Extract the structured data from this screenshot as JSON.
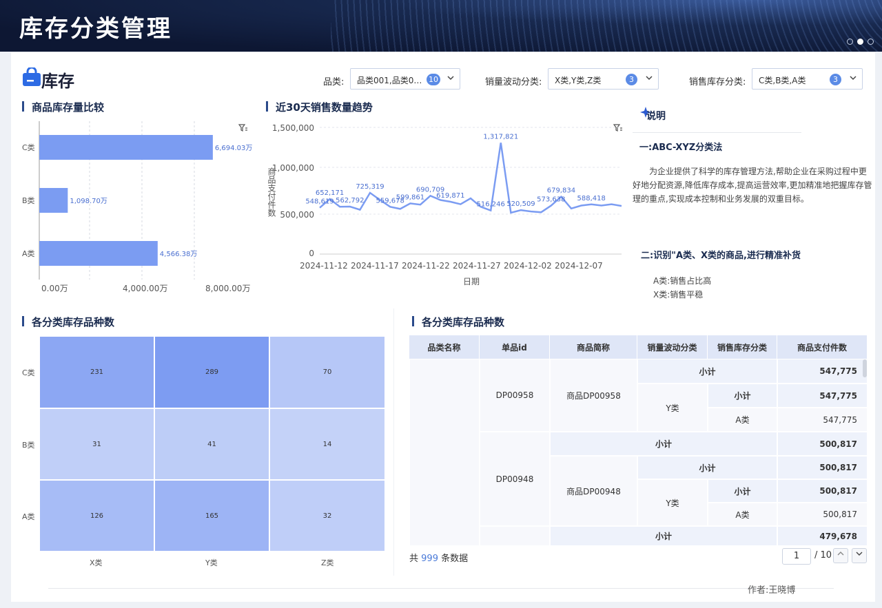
{
  "header": {
    "title": "库存分类管理"
  },
  "logo": {
    "text": "库存"
  },
  "filters": [
    {
      "label": "品类:",
      "value": "品类001,品类0…",
      "count": "10"
    },
    {
      "label": "销量波动分类:",
      "value": "X类,Y类,Z类",
      "count": "3"
    },
    {
      "label": "销售库存分类:",
      "value": "C类,B类,A类",
      "count": "3"
    }
  ],
  "inventory_chart": {
    "title": "商品库存量比较",
    "categories": [
      "C类",
      "B类",
      "A类"
    ],
    "labels": [
      "6,694.03万",
      "1,098.70万",
      "4,566.38万"
    ],
    "ticks": [
      "0.00万",
      "4,000.00万",
      "8,000.00万"
    ]
  },
  "trend_chart": {
    "title": "近30天销售数量趋势",
    "ylabel": "商品支付件数",
    "xlabel": "日期",
    "yticks": [
      "1,500,000",
      "1,000,000",
      "500,000",
      "0"
    ],
    "xticks": [
      "2024-11-12",
      "2024-11-17",
      "2024-11-22",
      "2024-11-27",
      "2024-12-02",
      "2024-12-07"
    ],
    "labels": [
      "548,619",
      "652,171",
      "562,792",
      "725,319",
      "559,678",
      "599,861",
      "690,709",
      "619,871",
      "516,246",
      "1,317,821",
      "520,509",
      "573,638",
      "679,834",
      "588,418"
    ]
  },
  "notes": {
    "title": "说明",
    "h1": "一:ABC-XYZ分类法",
    "p1": "为企业提供了科学的库存管理方法,帮助企业在采购过程中更好地分配资源,降低库存成本,提高运营效率,更加精准地把握库存管理的重点,实现成本控制和业务发展的双重目标。",
    "h2": "二:识别\"A类、X类的商品,进行精准补货",
    "items": [
      "A类:销售占比高",
      "X类:销售平稳"
    ]
  },
  "heatmap": {
    "title": "各分类库存品种数",
    "rows": [
      "C类",
      "B类",
      "A类"
    ],
    "cols": [
      "X类",
      "Y类",
      "Z类"
    ],
    "values": [
      [
        "231",
        "289",
        "70"
      ],
      [
        "31",
        "41",
        "14"
      ],
      [
        "126",
        "165",
        "32"
      ]
    ]
  },
  "table": {
    "title": "各分类库存品种数",
    "columns": [
      "品类名称",
      "单品id",
      "商品简称",
      "销量波动分类",
      "销售库存分类",
      "商品支付件数"
    ],
    "subtotal": "小计",
    "group1": {
      "id": "DP00958",
      "name": "商品DP00958",
      "wave": "Y类",
      "stock": "A类",
      "v1": "547,775",
      "v2": "547,775",
      "v3": "547,775"
    },
    "group2": {
      "id": "DP00948",
      "name": "商品DP00948",
      "wave": "Y类",
      "stock": "A类",
      "v0": "500,817",
      "v1": "500,817",
      "v2": "500,817",
      "v3": "500,817"
    },
    "last_sub": "479,678"
  },
  "pager": {
    "prefix": "共",
    "count": "999",
    "suffix": "条数据",
    "page": "1",
    "total": "/ 10"
  },
  "footer": {
    "author": "作者:王晓博"
  },
  "chart_data": [
    {
      "type": "bar",
      "title": "商品库存量比较",
      "categories": [
        "C类",
        "B类",
        "A类"
      ],
      "values": [
        6694.03,
        1098.7,
        4566.38
      ],
      "unit": "万",
      "xlim": [
        0,
        8000
      ],
      "orientation": "horizontal",
      "color": "#7b9cf2"
    },
    {
      "type": "line",
      "title": "近30天销售数量趋势",
      "xlabel": "日期",
      "ylabel": "商品支付件数",
      "ylim": [
        0,
        1500000
      ],
      "x": [
        "2024-11-10",
        "2024-11-11",
        "2024-11-12",
        "2024-11-13",
        "2024-11-14",
        "2024-11-15",
        "2024-11-16",
        "2024-11-17",
        "2024-11-18",
        "2024-11-19",
        "2024-11-20",
        "2024-11-21",
        "2024-11-22",
        "2024-11-23",
        "2024-11-24",
        "2024-11-25",
        "2024-11-26",
        "2024-11-27",
        "2024-11-28",
        "2024-11-29",
        "2024-11-30",
        "2024-12-01",
        "2024-12-02",
        "2024-12-03",
        "2024-12-04",
        "2024-12-05",
        "2024-12-06",
        "2024-12-07",
        "2024-12-08",
        "2024-12-09",
        "2024-12-10"
      ],
      "values": [
        548619,
        652171,
        560000,
        562792,
        525000,
        725319,
        640000,
        559678,
        535000,
        599861,
        585000,
        690709,
        640000,
        619871,
        590000,
        660000,
        560000,
        516246,
        1317821,
        490000,
        520509,
        505000,
        495000,
        573638,
        679834,
        540000,
        575000,
        588418,
        575000,
        590000,
        570000
      ],
      "color": "#7b9cf2",
      "grid": true
    },
    {
      "type": "heatmap",
      "title": "各分类库存品种数",
      "rows": [
        "C类",
        "B类",
        "A类"
      ],
      "cols": [
        "X类",
        "Y类",
        "Z类"
      ],
      "values": [
        [
          231,
          289,
          70
        ],
        [
          31,
          41,
          14
        ],
        [
          126,
          165,
          32
        ]
      ]
    }
  ]
}
